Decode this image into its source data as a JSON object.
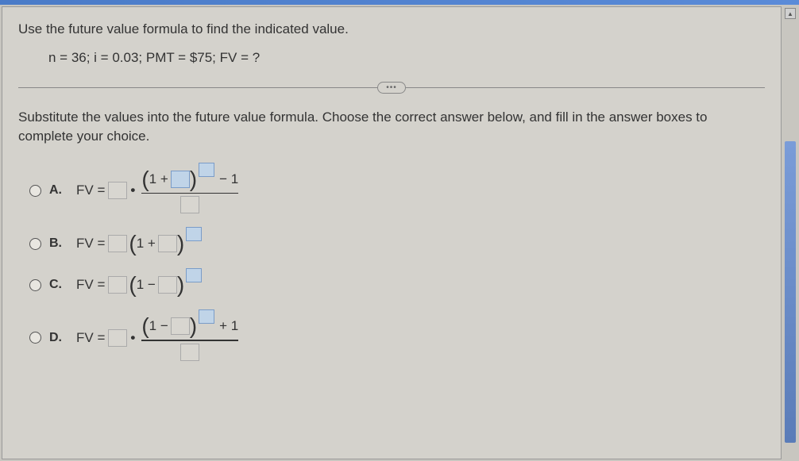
{
  "question": {
    "prompt": "Use the future value formula to find the indicated value.",
    "given": "n = 36; i = 0.03; PMT = $75; FV = ?"
  },
  "divider": "•••",
  "instruction": "Substitute the values into the future value formula. Choose the correct answer below, and fill in the answer boxes to complete your choice.",
  "choices": {
    "a": {
      "label": "A.",
      "fv": "FV =",
      "one_plus": "1 +",
      "minus_one": "− 1"
    },
    "b": {
      "label": "B.",
      "fv": "FV =",
      "one_plus": "1 +"
    },
    "c": {
      "label": "C.",
      "fv": "FV =",
      "one_minus": "1 −"
    },
    "d": {
      "label": "D.",
      "fv": "FV =",
      "one_minus": "1 −",
      "plus_one": "+ 1"
    }
  }
}
